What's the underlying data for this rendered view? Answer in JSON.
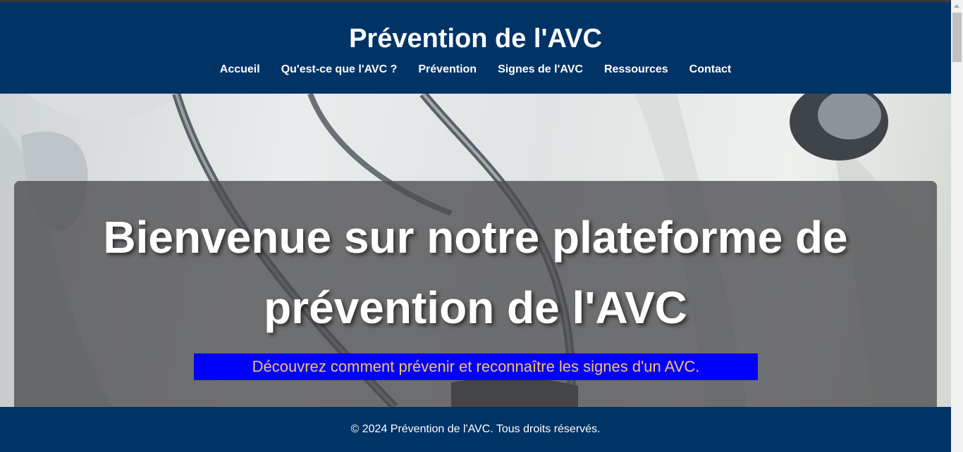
{
  "header": {
    "title": "Prévention de l'AVC",
    "nav": [
      {
        "label": "Accueil"
      },
      {
        "label": "Qu'est-ce que l'AVC ?"
      },
      {
        "label": "Prévention"
      },
      {
        "label": "Signes de l'AVC"
      },
      {
        "label": "Ressources"
      },
      {
        "label": "Contact"
      }
    ]
  },
  "hero": {
    "title": "Bienvenue sur notre plateforme de prévention de l'AVC",
    "subtitle": "Découvrez comment prévenir et reconnaître les signes d'un AVC."
  },
  "footer": {
    "text": "© 2024 Prévention de l'AVC. Tous droits réservés."
  },
  "colors": {
    "header_bg": "#003366",
    "subtitle_bg": "#0000ff",
    "subtitle_text": "#f5c26b"
  }
}
